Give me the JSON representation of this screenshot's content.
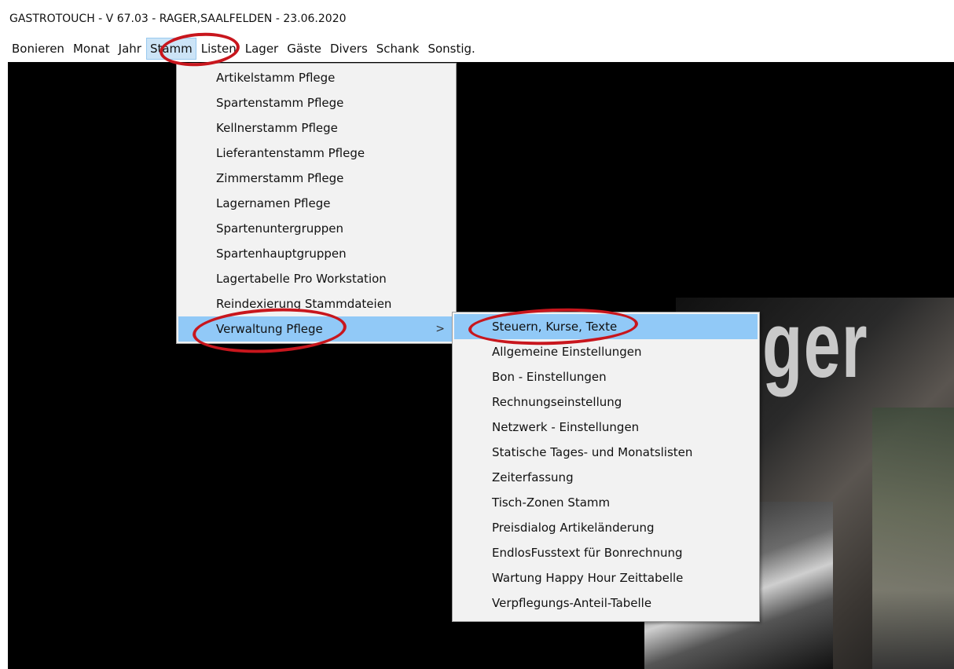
{
  "window": {
    "title": "GASTROTOUCH  -  V 67.03  -  RAGER,SAALFELDEN  -  23.06.2020"
  },
  "menubar": {
    "items": [
      "Bonieren",
      "Monat",
      "Jahr",
      "Stamm",
      "Listen",
      "Lager",
      "Gäste",
      "Divers",
      "Schank",
      "Sonstig."
    ],
    "active": "Stamm"
  },
  "stamm_menu": {
    "items": [
      "Artikelstamm Pflege",
      "Spartenstamm Pflege",
      "Kellnerstamm Pflege",
      "Lieferantenstamm Pflege",
      "Zimmerstamm Pflege",
      "Lagernamen Pflege",
      "Spartenuntergruppen",
      "Spartenhauptgruppen",
      "Lagertabelle Pro Workstation",
      "Reindexierung Stammdateien",
      "Verwaltung Pflege"
    ],
    "submenu_arrow": ">",
    "highlighted": "Verwaltung Pflege"
  },
  "verwaltung_submenu": {
    "items": [
      "Steuern, Kurse, Texte",
      "Allgemeine Einstellungen",
      "Bon - Einstellungen",
      "Rechnungseinstellung",
      "Netzwerk - Einstellungen",
      "Statische Tages- und Monatslisten",
      "Zeiterfassung",
      "Tisch-Zonen Stamm",
      "Preisdialog Artikeländerung",
      "EndlosFusstext für Bonrechnung",
      "Wartung Happy Hour Zeittabelle",
      "Verpflegungs-Anteil-Tabelle"
    ],
    "highlighted": "Steuern, Kurse, Texte"
  },
  "background": {
    "logo_text": "ger"
  },
  "colors": {
    "menu_highlight": "#91c9f7",
    "annotation": "#c8161d",
    "workspace": "#000000"
  }
}
